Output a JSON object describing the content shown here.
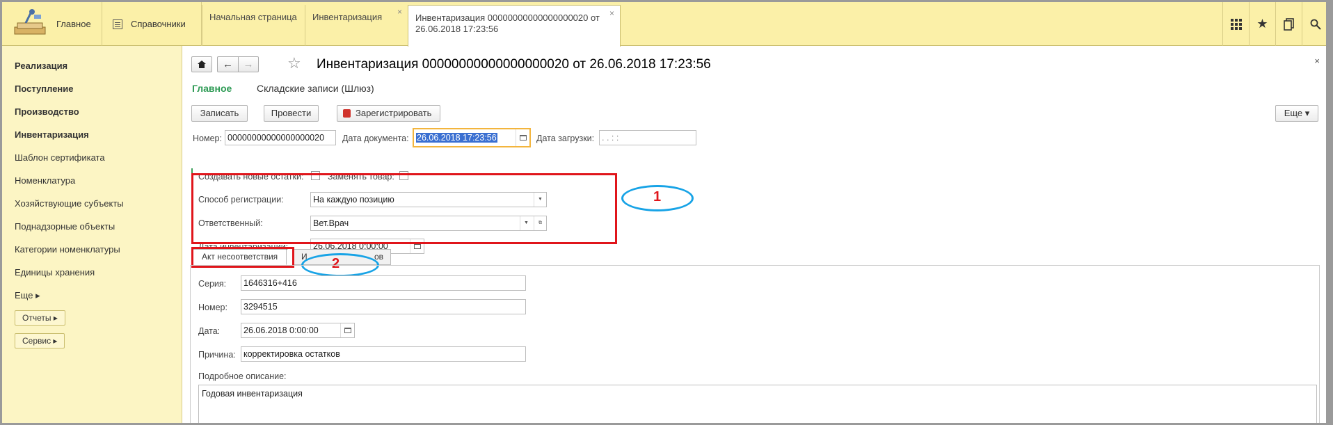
{
  "topbar": {
    "main_label": "Главное",
    "refs_label": "Справочники",
    "tabs": [
      {
        "label": "Начальная страница"
      },
      {
        "label": "Инвентаризация"
      },
      {
        "label_line1": "Инвентаризация 00000000000000000020 от",
        "label_line2": "26.06.2018 17:23:56"
      }
    ],
    "close_glyph": "×",
    "icons": [
      "apps-grid-icon",
      "star-icon",
      "history-icon",
      "search-icon"
    ]
  },
  "sidebar": {
    "items": [
      {
        "label": "Реализация",
        "bold": true
      },
      {
        "label": "Поступление",
        "bold": true
      },
      {
        "label": "Производство",
        "bold": true
      },
      {
        "label": "Инвентаризация",
        "bold": true
      },
      {
        "label": "Шаблон сертификата",
        "bold": false
      },
      {
        "label": "Номенклатура",
        "bold": false
      },
      {
        "label": "Хозяйствующие субъекты",
        "bold": false
      },
      {
        "label": "Поднадзорные объекты",
        "bold": false
      },
      {
        "label": "Категории номенклатуры",
        "bold": false
      },
      {
        "label": "Единицы хранения",
        "bold": false
      },
      {
        "label": "Еще ▸",
        "bold": false
      }
    ],
    "buttons": [
      {
        "label": "Отчеты ▸"
      },
      {
        "label": "Сервис ▸"
      }
    ]
  },
  "document": {
    "title": "Инвентаризация 00000000000000000020 от 26.06.2018 17:23:56",
    "close": "×",
    "nav_links": {
      "main": "Главное",
      "warehouse": "Складские записи (Шлюз)"
    },
    "buttons": {
      "write": "Записать",
      "post": "Провести",
      "register": "Зарегистрировать",
      "more": "Еще ▾"
    },
    "header_fields": {
      "number_label": "Номер:",
      "number_value": "00000000000000000020",
      "doc_date_label": "Дата документа:",
      "doc_date_value": "26.06.2018 17:23:56",
      "load_date_label": "Дата загрузки:",
      "load_date_value": " .  .      :  :"
    },
    "checkboxes": {
      "create_new_label": "Создавать новые остатки:",
      "replace_label": "Заменять товар:"
    },
    "registration": {
      "method_label": "Способ регистрации:",
      "method_value": "На каждую позицию",
      "responsible_label": "Ответственный:",
      "responsible_value": "Вет.Врач",
      "inv_date_label": "Дата инвентаризации:",
      "inv_date_value": "26.06.2018  0:00:00"
    },
    "callouts": {
      "one": "1",
      "two": "2"
    },
    "tabs": [
      {
        "label": "Акт несоответствия"
      },
      {
        "label": "И",
        "tail": "ов"
      }
    ],
    "act": {
      "series_label": "Серия:",
      "series_value": "1646316+416",
      "number_label": "Номер:",
      "number_value": "3294515",
      "date_label": "Дата:",
      "date_value": "26.06.2018  0:00:00",
      "reason_label": "Причина:",
      "reason_value": "корректировка остатков",
      "desc_label": "Подробное описание:",
      "desc_value": "Годовая инвентаризация"
    }
  },
  "colors": {
    "topbar": "#fbf0a8",
    "sidebar": "#fcf5c4",
    "accent_green": "#2d9a54",
    "annotation_red": "#e0151b",
    "annotation_blue": "#17a3e6"
  }
}
